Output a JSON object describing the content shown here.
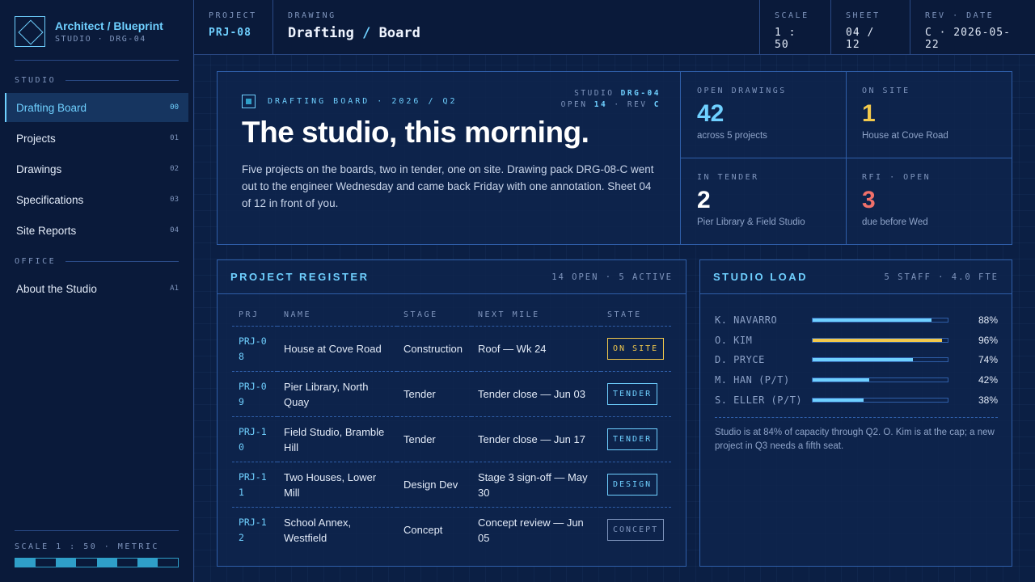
{
  "brand": {
    "title": "Architect / Blueprint",
    "subtitle": "STUDIO · DRG-04"
  },
  "nav": {
    "section_studio": "STUDIO",
    "section_office": "OFFICE",
    "items": [
      {
        "label": "Drafting Board",
        "num": "00",
        "active": true
      },
      {
        "label": "Projects",
        "num": "01"
      },
      {
        "label": "Drawings",
        "num": "02"
      },
      {
        "label": "Specifications",
        "num": "03"
      },
      {
        "label": "Site Reports",
        "num": "04"
      }
    ],
    "office_items": [
      {
        "label": "About the Studio",
        "num": "A1"
      }
    ]
  },
  "scale_footer": {
    "label": "SCALE 1 : 50 · METRIC"
  },
  "topbar": {
    "project_label": "PROJECT",
    "project": "PRJ-08",
    "drawing_label": "DRAWING",
    "drawing_a": "Drafting",
    "drawing_sep": "/",
    "drawing_b": "Board",
    "scale_label": "SCALE",
    "scale": "1 : 50",
    "sheet_label": "SHEET",
    "sheet": "04 / 12",
    "rev_label": "REV · DATE",
    "rev": "C · 2026-05-22"
  },
  "hero": {
    "tag": "DRAFTING BOARD · 2026 / Q2",
    "meta_studio_label": "STUDIO",
    "meta_studio": "DRG-04",
    "meta_open_label": "OPEN",
    "meta_open": "14",
    "meta_rev_label": "· REV",
    "meta_rev": "C",
    "title": "The studio, this morning.",
    "description": "Five projects on the boards, two in tender, one on site. Drawing pack DRG-08-C went out to the engineer Wednesday and came back Friday with one annotation. Sheet 04 of 12 in front of you."
  },
  "stats": [
    {
      "label": "OPEN DRAWINGS",
      "value": "42",
      "note": "across 5 projects",
      "color": "#6fd0ff"
    },
    {
      "label": "ON SITE",
      "value": "1",
      "note": "House at Cove Road",
      "color": "#f2c94c"
    },
    {
      "label": "IN TENDER",
      "value": "2",
      "note": "Pier Library & Field Studio",
      "color": "#ffffff"
    },
    {
      "label": "RFI · OPEN",
      "value": "3",
      "note": "due before Wed",
      "color": "#f0706a"
    }
  ],
  "register": {
    "title": "PROJECT REGISTER",
    "meta": "14 OPEN · 5 ACTIVE",
    "headers": {
      "prj": "PRJ",
      "name": "NAME",
      "stage": "STAGE",
      "next": "NEXT MILE",
      "state": "STATE"
    },
    "rows": [
      {
        "prj": "PRJ-08",
        "name": "House at Cove Road",
        "stage": "Construction",
        "next": "Roof — Wk 24",
        "state": "ON SITE"
      },
      {
        "prj": "PRJ-09",
        "name": "Pier Library, North Quay",
        "stage": "Tender",
        "next": "Tender close — Jun 03",
        "state": "TENDER"
      },
      {
        "prj": "PRJ-10",
        "name": "Field Studio, Bramble Hill",
        "stage": "Tender",
        "next": "Tender close — Jun 17",
        "state": "TENDER"
      },
      {
        "prj": "PRJ-11",
        "name": "Two Houses, Lower Mill",
        "stage": "Design Dev",
        "next": "Stage 3 sign-off — May 30",
        "state": "DESIGN"
      },
      {
        "prj": "PRJ-12",
        "name": "School Annex, Westfield",
        "stage": "Concept",
        "next": "Concept review — Jun 05",
        "state": "CONCEPT"
      }
    ]
  },
  "load": {
    "title": "STUDIO LOAD",
    "meta": "5 STAFF · 4.0 FTE",
    "rows": [
      {
        "name": "K. NAVARRO",
        "pct": 88,
        "pct_label": "88%"
      },
      {
        "name": "O. KIM",
        "pct": 96,
        "pct_label": "96%"
      },
      {
        "name": "D. PRYCE",
        "pct": 74,
        "pct_label": "74%"
      },
      {
        "name": "M. HAN (P/T)",
        "pct": 42,
        "pct_label": "42%"
      },
      {
        "name": "S. ELLER (P/T)",
        "pct": 38,
        "pct_label": "38%"
      }
    ],
    "note": "Studio is at 84% of capacity through Q2. O. Kim is at the cap; a new project in Q3 needs a fifth seat."
  },
  "colors": {
    "accent": "#6fd0ff",
    "warn": "#f2c94c",
    "alert": "#f0706a",
    "bg": "#0b1f44"
  }
}
